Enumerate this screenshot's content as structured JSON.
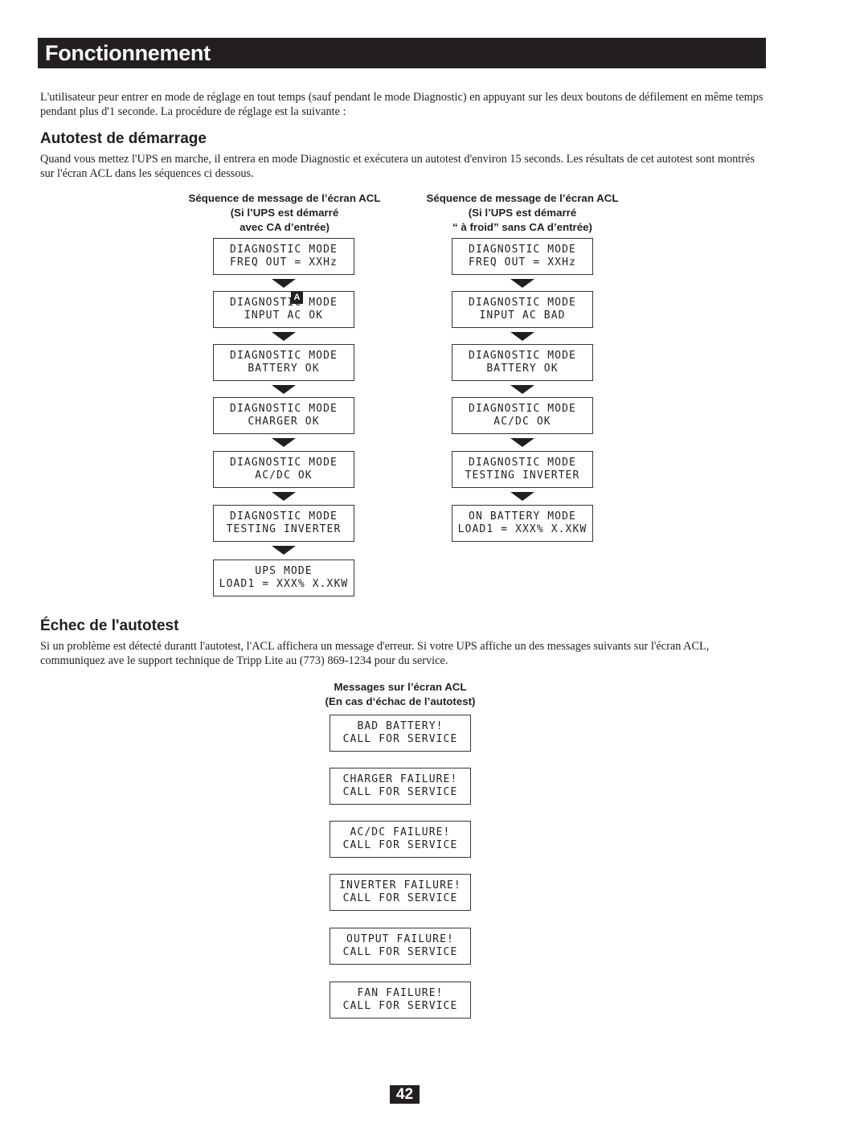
{
  "header": {
    "title": "Fonctionnement"
  },
  "intro": "L'utilisateur peur entrer en mode de réglage en tout temps (sauf pendant le mode Diagnostic) en appuyant sur les deux boutons de défilement en même temps pendant plus d'1 seconde. La procédure de réglage est la suivante :",
  "startup_test": {
    "heading": "Autotest de démarrage",
    "description": "Quand vous mettez l'UPS en marche, il entrera en mode Diagnostic et exécutera un autotest d'environ 15 seconds. Les résultats de cet autotest sont montrés sur l'écran ACL dans les séquences ci dessous.",
    "marker_label": "A",
    "columns": [
      {
        "header": [
          "Séquence de message de l’écran ACL",
          "(Si l’UPS est démarré",
          "avec CA d’entrée)"
        ],
        "screens": [
          [
            "DIAGNOSTIC MODE",
            "FREQ OUT = XXHz"
          ],
          [
            "DIAGNOSTIC MODE",
            "INPUT AC OK"
          ],
          [
            "DIAGNOSTIC MODE",
            "BATTERY OK"
          ],
          [
            "DIAGNOSTIC MODE",
            "CHARGER OK"
          ],
          [
            "DIAGNOSTIC MODE",
            "AC/DC OK"
          ],
          [
            "DIAGNOSTIC MODE",
            "TESTING INVERTER"
          ],
          [
            "UPS MODE",
            "LOAD1 = XXX% X.XKW"
          ]
        ]
      },
      {
        "header": [
          "Séquence de message de l’écran ACL",
          "(Si l’UPS est démarré",
          "“ à froid” sans CA d’entrée)"
        ],
        "screens": [
          [
            "DIAGNOSTIC MODE",
            "FREQ OUT = XXHz"
          ],
          [
            "DIAGNOSTIC MODE",
            "INPUT AC BAD"
          ],
          [
            "DIAGNOSTIC MODE",
            "BATTERY OK"
          ],
          [
            "DIAGNOSTIC MODE",
            "AC/DC OK"
          ],
          [
            "DIAGNOSTIC MODE",
            "TESTING INVERTER"
          ],
          [
            "ON BATTERY MODE",
            "LOAD1 = XXX% X.XKW"
          ]
        ]
      }
    ]
  },
  "failure": {
    "heading": "Échec de l'autotest",
    "description": "Si un problème est détecté durantt l'autotest, l'ACL affichera un message d'erreur. Si votre UPS affiche un des messages suivants sur l'écran ACL, communiquez ave le support technique de Tripp Lite au (773) 869-1234 pour du service.",
    "header": [
      "Messages sur l’écran ACL",
      "(En cas d‘échac de l’autotest)"
    ],
    "screens": [
      [
        "BAD BATTERY!",
        "CALL FOR SERVICE"
      ],
      [
        "CHARGER FAILURE!",
        "CALL FOR SERVICE"
      ],
      [
        "AC/DC FAILURE!",
        "CALL FOR SERVICE"
      ],
      [
        "INVERTER FAILURE!",
        "CALL FOR SERVICE"
      ],
      [
        "OUTPUT FAILURE!",
        "CALL FOR SERVICE"
      ],
      [
        "FAN FAILURE!",
        "CALL FOR SERVICE"
      ]
    ]
  },
  "page_number": "42"
}
